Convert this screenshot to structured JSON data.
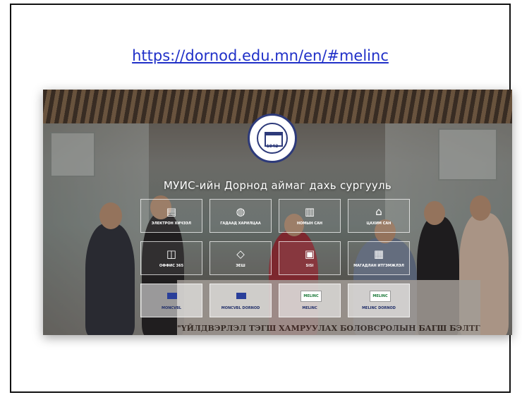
{
  "link": {
    "url_text": "https://dornod.edu.mn/en/#melinc"
  },
  "site": {
    "title": "МУИС-ийн Дорнод аймаг дахь сургууль",
    "logo_year": "1942"
  },
  "tiles": [
    {
      "label": "ЭЛЕКТРОН ХИЧЭЭЛ",
      "icon": "document-icon",
      "glyph": "▤"
    },
    {
      "label": "ГАДААД ХАРИЛЦАА",
      "icon": "globe-icon",
      "glyph": "◍"
    },
    {
      "label": "НОМЫН САН",
      "icon": "library-icon",
      "glyph": "▥"
    },
    {
      "label": "ЦАХИМ САН",
      "icon": "institution-icon",
      "glyph": "⌂"
    },
    {
      "label": "ОФФИС 365",
      "icon": "office-icon",
      "glyph": "◫"
    },
    {
      "label": "ЭЕШ",
      "icon": "graduation-cap-icon",
      "glyph": "◇"
    },
    {
      "label": "SISI",
      "icon": "sisi-icon",
      "glyph": "▣"
    },
    {
      "label": "МАГАДЛАН ИТГЭМЖЛЭЛ",
      "icon": "certificate-icon",
      "glyph": "▦"
    },
    {
      "label": "MONCVBL",
      "icon": "eu-flag-icon",
      "glyph": ""
    },
    {
      "label": "MONCVBL DORNOD",
      "icon": "eu-flag-icon",
      "glyph": ""
    },
    {
      "label": "MELINC",
      "icon": "melinc-logo-icon",
      "badge": "MELINC"
    },
    {
      "label": "MELINC DORNOD",
      "icon": "melinc-logo-icon",
      "badge": "MELINC"
    }
  ],
  "banner": {
    "text": "\"ҮЙЛДВЭРЛЭЛ ТЭГШ ХАМРУУЛАХ БОЛОВСРОЛЫН БАГШ БЭЛТГЭХ\" төсөл"
  },
  "colors": {
    "link": "#2030c8",
    "logo_blue": "#2d3a7a",
    "frame": "#111111"
  }
}
